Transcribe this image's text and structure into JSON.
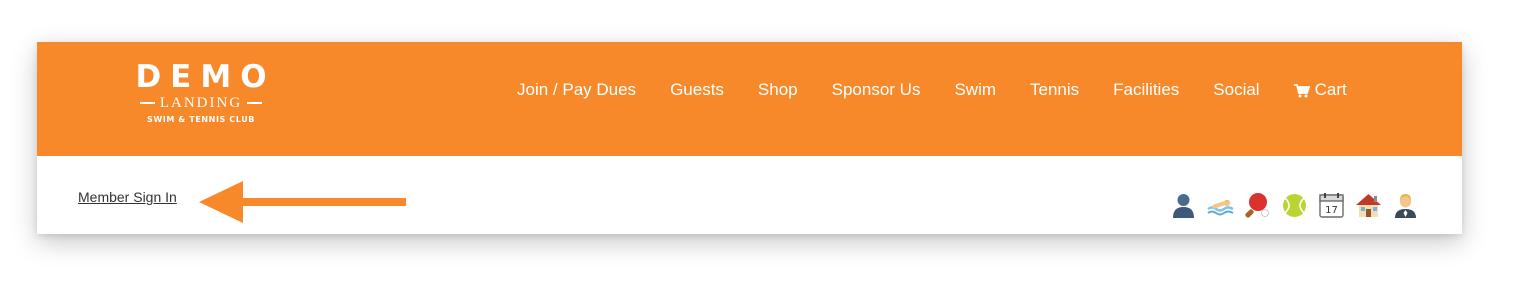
{
  "colors": {
    "header_bg": "#f7892a",
    "nav_text": "#ffffff",
    "arrow": "#f7892a",
    "signin_text": "#333333"
  },
  "logo": {
    "word": "DEMO",
    "sub": "LANDING",
    "tagline": "SWIM & TENNIS CLUB"
  },
  "nav": {
    "items": [
      {
        "label": "Join / Pay Dues"
      },
      {
        "label": "Guests"
      },
      {
        "label": "Shop"
      },
      {
        "label": "Sponsor Us"
      },
      {
        "label": "Swim"
      },
      {
        "label": "Tennis"
      },
      {
        "label": "Facilities"
      },
      {
        "label": "Social"
      }
    ],
    "cart": {
      "label": "Cart",
      "icon": "cart-icon"
    }
  },
  "member": {
    "signin_label": "Member Sign In",
    "arrow_icon": "left-arrow-icon"
  },
  "quick_icons": [
    {
      "name": "member-icon"
    },
    {
      "name": "swimmer-icon"
    },
    {
      "name": "ping-pong-icon"
    },
    {
      "name": "tennis-ball-icon"
    },
    {
      "name": "calendar-icon",
      "day": "17"
    },
    {
      "name": "clubhouse-icon"
    },
    {
      "name": "staff-icon"
    }
  ]
}
